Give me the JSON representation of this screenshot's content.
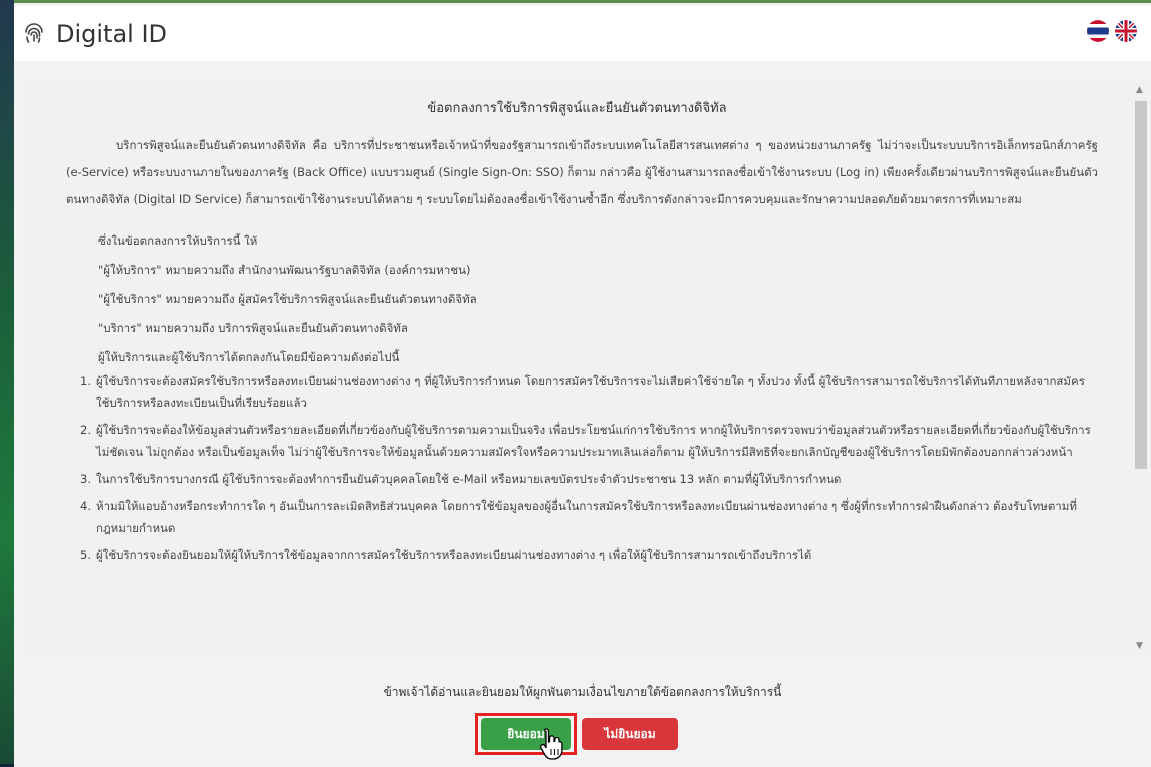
{
  "app": {
    "title": "Digital ID"
  },
  "languages": [
    {
      "name": "thai-flag-icon"
    },
    {
      "name": "uk-flag-icon"
    }
  ],
  "document": {
    "title": "ข้อตกลงการใช้บริการพิสูจน์และยืนยันตัวตนทางดิจิทัล",
    "intro": "บริการพิสูจน์และยืนยันตัวตนทางดิจิทัล คือ บริการที่ประชาชนหรือเจ้าหน้าที่ของรัฐสามารถเข้าถึงระบบเทคโนโลยีสารสนเทศต่าง ๆ ของหน่วยงานภาครัฐ ไม่ว่าจะเป็นระบบบริการอิเล็กทรอนิกส์ภาครัฐ (e-Service) หรือระบบงานภายในของภาครัฐ (Back Office) แบบรวมศูนย์ (Single Sign-On: SSO) ก็ตาม กล่าวคือ ผู้ใช้งานสามารถลงชื่อเข้าใช้งานระบบ (Log in) เพียงครั้งเดียวผ่านบริการพิสูจน์และยืนยันตัวตนทางดิจิทัล (Digital ID Service) ก็สามารถเข้าใช้งานระบบได้หลาย ๆ ระบบโดยไม่ต้องลงชื่อเข้าใช้งานซ้ำอีก ซึ่งบริการดังกล่าวจะมีการควบคุมและรักษาความปลอดภัยด้วยมาตรการที่เหมาะสม",
    "definitions": [
      "ซึ่งในข้อตกลงการให้บริการนี้ ให้",
      "\"ผู้ให้บริการ\" หมายความถึง สำนักงานพัฒนารัฐบาลดิจิทัล (องค์การมหาชน)",
      "\"ผู้ใช้บริการ\" หมายความถึง ผู้สมัครใช้บริการพิสูจน์และยืนยันตัวตนทางดิจิทัล",
      "\"บริการ\" หมายความถึง บริการพิสูจน์และยืนยันตัวตนทางดิจิทัล",
      "ผู้ให้บริการและผู้ใช้บริการได้ตกลงกันโดยมีข้อความดังต่อไปนี้"
    ],
    "terms": [
      {
        "num": "1.",
        "text": "ผู้ใช้บริการจะต้องสมัครใช้บริการหรือลงทะเบียนผ่านช่องทางต่าง ๆ ที่ผู้ให้บริการกำหนด โดยการสมัครใช้บริการจะไม่เสียค่าใช้จ่ายใด ๆ ทั้งปวง ทั้งนี้ ผู้ใช้บริการสามารถใช้บริการได้ทันทีภายหลังจากสมัครใช้บริการหรือลงทะเบียนเป็นที่เรียบร้อยแล้ว"
      },
      {
        "num": "2.",
        "text": "ผู้ใช้บริการจะต้องให้ข้อมูลส่วนตัวหรือรายละเอียดที่เกี่ยวข้องกับผู้ใช้บริการตามความเป็นจริง เพื่อประโยชน์แก่การใช้บริการ หากผู้ให้บริการตรวจพบว่าข้อมูลส่วนตัวหรือรายละเอียดที่เกี่ยวข้องกับผู้ใช้บริการไม่ชัดเจน ไม่ถูกต้อง หรือเป็นข้อมูลเท็จ ไม่ว่าผู้ใช้บริการจะให้ข้อมูลนั้นด้วยความสมัครใจหรือความประมาทเลินเล่อก็ตาม ผู้ให้บริการมีสิทธิที่จะยกเลิกบัญชีของผู้ใช้บริการโดยมิพักต้องบอกกล่าวล่วงหน้า"
      },
      {
        "num": "3.",
        "text": "ในการใช้บริการบางกรณี ผู้ใช้บริการจะต้องทำการยืนยันตัวบุคคลโดยใช้ e-Mail หรือหมายเลขบัตรประจำตัวประชาชน 13 หลัก ตามที่ผู้ให้บริการกำหนด"
      },
      {
        "num": "4.",
        "text": "ห้ามมิให้แอบอ้างหรือกระทำการใด ๆ อันเป็นการละเมิดสิทธิส่วนบุคคล โดยการใช้ข้อมูลของผู้อื่นในการสมัครใช้บริการหรือลงทะเบียนผ่านช่องทางต่าง ๆ ซึ่งผู้ที่กระทำการฝ่าฝืนดังกล่าว ต้องรับโทษตามที่กฎหมายกำหนด"
      },
      {
        "num": "5.",
        "text": "ผู้ใช้บริการจะต้องยินยอมให้ผู้ให้บริการใช้ข้อมูลจากการสมัครใช้บริการหรือลงทะเบียนผ่านช่องทางต่าง ๆ เพื่อให้ผู้ใช้บริการสามารถเข้าถึงบริการได้"
      }
    ]
  },
  "consent": {
    "statement": "ข้าพเจ้าได้อ่านและยินยอมให้ผูกพันตามเงื่อนไขภายใต้ข้อตกลงการให้บริการนี้",
    "accept_label": "ยินยอม",
    "decline_label": "ไม่ยินยอม"
  },
  "colors": {
    "accept": "#3aa047",
    "decline": "#d9363b",
    "highlight": "#e52222"
  }
}
